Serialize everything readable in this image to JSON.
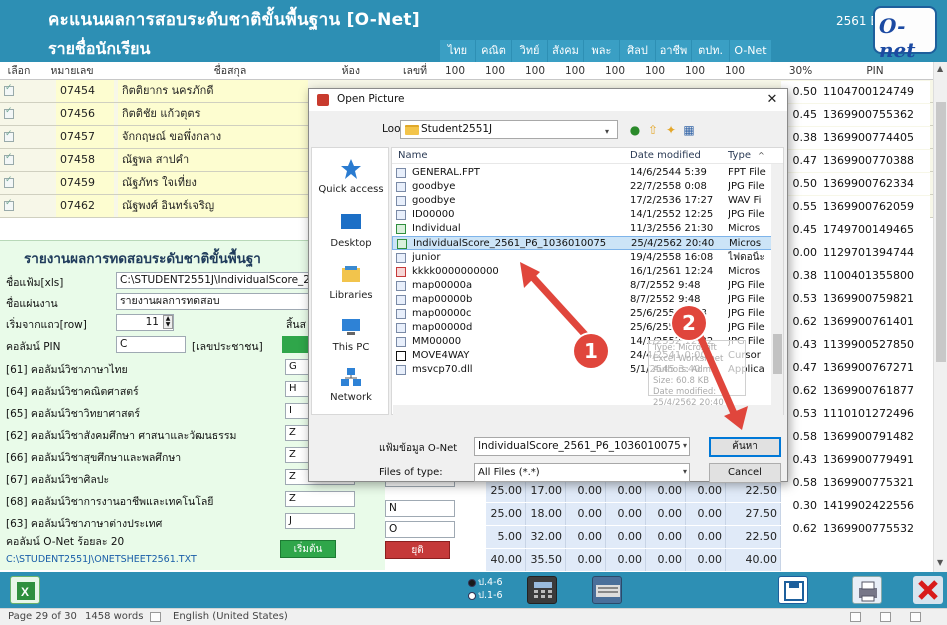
{
  "app": {
    "title": "คะแนนผลการสอบระดับชาติขั้นพื้นฐาน [O-Net]",
    "subtitle": "รายชื่อนักเรียน",
    "year": "2561",
    "year_suffix": "E",
    "logo_text": "O-net",
    "subject_tabs": [
      "ไทย",
      "คณิต",
      "วิทย์",
      "สังคม",
      "พละ",
      "ศิลป",
      "อาชีพ",
      "ตปท.",
      "O-Net"
    ]
  },
  "table": {
    "headers": [
      "เลือก",
      "หมายเลข",
      "ชื่อสกุล",
      "ห้อง",
      "เลขที่",
      "100",
      "100",
      "100",
      "100",
      "100",
      "100",
      "100",
      "100",
      "30%",
      "PIN"
    ],
    "rows": [
      {
        "id": "07454",
        "name": "กิตติยากร นครภักดี",
        "pct": "0.50",
        "pin": "1104700124749"
      },
      {
        "id": "07456",
        "name": "กิตติชัย แก้วตุตร",
        "pct": "0.45",
        "pin": "1369900755362"
      },
      {
        "id": "07457",
        "name": "จักกฤษณ์ ขอพึ่งกลาง",
        "pct": "0.38",
        "pin": "1369900774405"
      },
      {
        "id": "07458",
        "name": "ณัฐพล สาปคำ",
        "pct": "0.47",
        "pin": "1369900770388"
      },
      {
        "id": "07459",
        "name": "ณัฐภัทร ใจเที่ยง",
        "pct": "0.50",
        "pin": "1369900762334"
      },
      {
        "id": "07462",
        "name": "ณัฐพงศ์ อินทร์เจริญ",
        "pct": "0.55",
        "pin": "1369900762059"
      },
      {
        "id": "",
        "name": "",
        "pct": "0.45",
        "pin": "1749700149465"
      },
      {
        "id": "",
        "name": "",
        "pct": "0.00",
        "pin": "1129701394744"
      },
      {
        "id": "",
        "name": "",
        "pct": "0.38",
        "pin": "1100401355800"
      },
      {
        "id": "",
        "name": "",
        "pct": "0.53",
        "pin": "1369900759821"
      },
      {
        "id": "",
        "name": "",
        "pct": "0.62",
        "pin": "1369900761401"
      },
      {
        "id": "",
        "name": "",
        "pct": "0.43",
        "pin": "1139900527850"
      },
      {
        "id": "",
        "name": "",
        "pct": "0.47",
        "pin": "1369900767271"
      },
      {
        "id": "",
        "name": "",
        "pct": "0.62",
        "pin": "1369900761877"
      },
      {
        "id": "",
        "name": "",
        "pct": "0.53",
        "pin": "1110101272496"
      },
      {
        "id": "",
        "name": "",
        "pct": "0.58",
        "pin": "1369900791482"
      },
      {
        "id": "",
        "name": "",
        "pct": "0.43",
        "pin": "1369900779491"
      },
      {
        "id": "",
        "name": "",
        "pct": "0.58",
        "pin": "1369900775321"
      },
      {
        "id": "",
        "name": "",
        "pct": "0.30",
        "pin": "1419902422556"
      },
      {
        "id": "",
        "name": "",
        "pct": "0.62",
        "pin": "1369900775532"
      }
    ],
    "score_rows": [
      [
        "25.00",
        "17.00",
        "0.00",
        "0.00",
        "0.00",
        "0.00",
        "22.50"
      ],
      [
        "25.00",
        "18.00",
        "0.00",
        "0.00",
        "0.00",
        "0.00",
        "27.50"
      ],
      [
        "5.00",
        "32.00",
        "0.00",
        "0.00",
        "0.00",
        "0.00",
        "22.50"
      ],
      [
        "40.00",
        "35.50",
        "0.00",
        "0.00",
        "0.00",
        "0.00",
        "40.00"
      ]
    ]
  },
  "report": {
    "title": "รายงานผลการทดสอบระดับชาติขั้นพื้นฐา",
    "file_label": "ชื่อแฟ้ม[xls]",
    "file_value": "C:\\STUDENT2551J\\IndividualScore_25(",
    "sheet_label": "ชื่อแผ่นงาน",
    "sheet_value": "รายงานผลการทดสอบ",
    "startrow_label": "เริ่มจากแถว[row]",
    "startrow_value": "11",
    "endrow_partial": "สิ้นส",
    "pin_label": "คอลัมน์ PIN",
    "pin_col": "C",
    "pin_note": "[เลขประชาชน]",
    "columns": [
      {
        "label": "[61] คอลัมน์วิชาภาษาไทย",
        "code": "G"
      },
      {
        "label": "[64] คอลัมน์วิชาคณิตศาสตร์",
        "code": "H"
      },
      {
        "label": "[65] คอลัมน์วิชาวิทยาศาสตร์",
        "code": "I"
      },
      {
        "label": "[62] คอลัมน์วิชาสังคมศึกษา ศาสนาและวัฒนธรรม",
        "code": "Z"
      },
      {
        "label": "[66] คอลัมน์วิชาสุขศึกษาและพลศึกษา",
        "code": "Z"
      },
      {
        "label": "[67] คอลัมน์วิชาศิลปะ",
        "code": "Z"
      },
      {
        "label": "[68] คอลัมน์วิชาการงานอาชีพและเทคโนโลยี",
        "code": "Z"
      },
      {
        "label": "[63] คอลัมน์วิชาภาษาต่างประเทศ",
        "code": "J"
      }
    ],
    "extra_codes": [
      "Z",
      "N",
      "O"
    ],
    "onet_label": "คอลัมน์ O-Net ร้อยละ 20",
    "path_text": "C:\\STUDENT2551J\\ONETSHEET2561.TXT",
    "start_btn": "เริ่มต้น",
    "stop_btn": "ยุติ"
  },
  "bottombar": {
    "radio_1": "ป.4-6",
    "radio_2": "ป.1-6"
  },
  "statusbar": {
    "page": "Page 29 of 30",
    "words": "1458 words",
    "language": "English (United States)"
  },
  "dialog": {
    "title": "Open Picture",
    "lookin_label": "Look in:",
    "lookin_value": "Student2551J",
    "places": [
      "Quick access",
      "Desktop",
      "Libraries",
      "This PC",
      "Network"
    ],
    "columns": [
      "Name",
      "Date modified",
      "Type"
    ],
    "files": [
      {
        "name": "GENERAL.FPT",
        "date": "14/6/2544 5:39",
        "type": "FPT File"
      },
      {
        "name": "goodbye",
        "date": "22/7/2558 0:08",
        "type": "JPG File"
      },
      {
        "name": "goodbye",
        "date": "17/2/2536 17:27",
        "type": "WAV Fi"
      },
      {
        "name": "ID00000",
        "date": "14/1/2552 12:25",
        "type": "JPG File"
      },
      {
        "name": "Individual",
        "date": "11/3/2556 21:30",
        "type": "Micros"
      },
      {
        "name": "IndividualScore_2561_P6_1036010075",
        "date": "25/4/2562 20:40",
        "type": "Micros"
      },
      {
        "name": "junior",
        "date": "19/4/2558 16:08",
        "type": "ไฟดอนิ้ะ"
      },
      {
        "name": "kkkk0000000000",
        "date": "16/1/2561 12:24",
        "type": "Micros"
      },
      {
        "name": "map00000a",
        "date": "8/7/2552 9:48",
        "type": "JPG File"
      },
      {
        "name": "map00000b",
        "date": "8/7/2552 9:48",
        "type": "JPG File"
      },
      {
        "name": "map00000c",
        "date": "25/6/2552 0:38",
        "type": "JPG File"
      },
      {
        "name": "map00000d",
        "date": "25/6/2552 0:38",
        "type": "JPG File"
      },
      {
        "name": "MM00000",
        "date": "14/1/2552 12:22",
        "type": "JPG File"
      },
      {
        "name": "MOVE4WAY",
        "date": "24/4/2541 0:00",
        "type": "Cursor"
      },
      {
        "name": "msvcp70.dll",
        "date": "5/1/2545 3:40",
        "type": "Applica"
      }
    ],
    "tooltip": [
      "Type: Microsoft Excel Worksheet",
      "Authors: Admin",
      "Size: 60.8 KB",
      "Date modified: 25/4/2562 20:40"
    ],
    "filename_label": "แฟ้มข้อมูล O-Net",
    "filename_value": "IndividualScore_2561_P6_1036010075",
    "filetype_label": "Files of type:",
    "filetype_value": "All Files (*.*)",
    "find_btn": "ค้นหา",
    "cancel_btn": "Cancel"
  },
  "annotations": [
    "1",
    "2"
  ],
  "colors": {
    "header_bg": "#2d8fb4",
    "row_bg": "#f7f7e8",
    "report_bg": "#e9fbe9",
    "selection": "#cce4f7",
    "annotation": "#e0463c",
    "start_btn": "#2fa64a",
    "stop_btn": "#c53939"
  }
}
